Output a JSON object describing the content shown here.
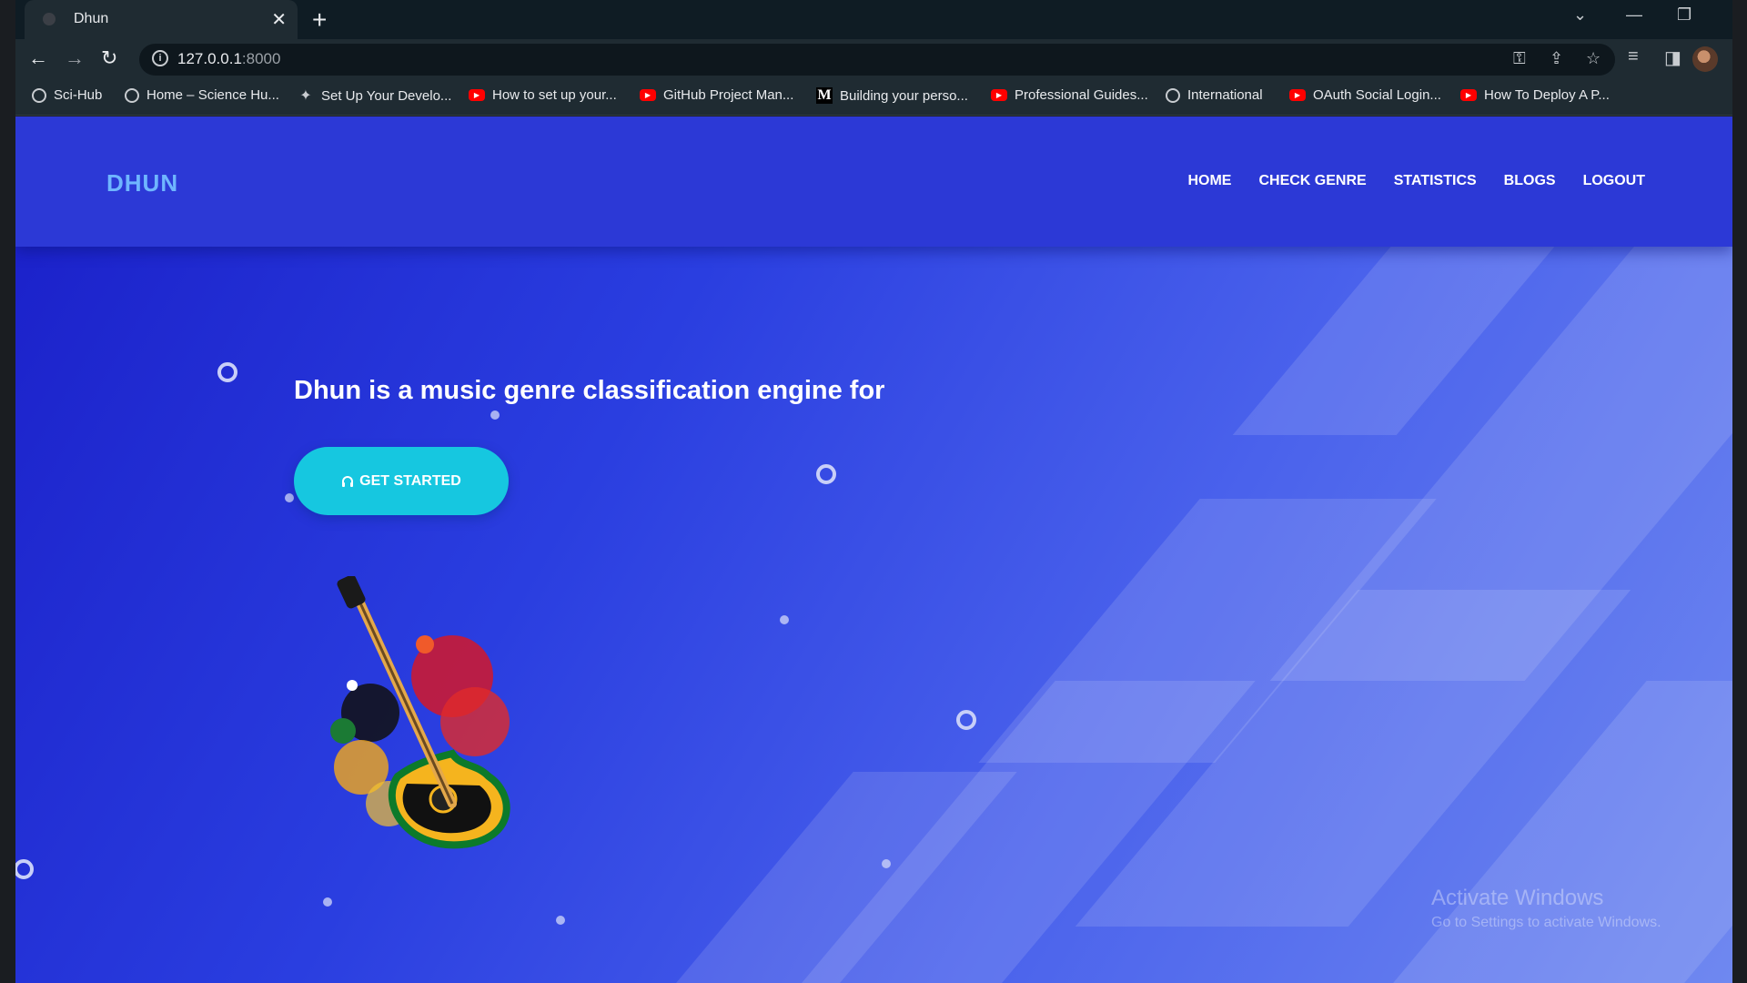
{
  "browser": {
    "tab_title": "Dhun",
    "url_host": "127.0.0.1",
    "url_port": ":8000",
    "bookmarks": [
      {
        "label": "Sci-Hub",
        "icon": "globe-icon"
      },
      {
        "label": "Home – Science Hu...",
        "icon": "globe-icon"
      },
      {
        "label": "Set Up Your Develo...",
        "icon": "gear-icon"
      },
      {
        "label": "How to set up your...",
        "icon": "youtube-icon"
      },
      {
        "label": "GitHub Project Man...",
        "icon": "youtube-icon"
      },
      {
        "label": "Building your perso...",
        "icon": "medium-icon"
      },
      {
        "label": "Professional Guides...",
        "icon": "youtube-icon"
      },
      {
        "label": "International",
        "icon": "globe-icon"
      },
      {
        "label": "OAuth Social Login...",
        "icon": "youtube-icon"
      },
      {
        "label": "How To Deploy A P...",
        "icon": "youtube-icon"
      }
    ]
  },
  "site": {
    "logo": "DHUN",
    "nav": [
      "HOME",
      "CHECK GENRE",
      "STATISTICS",
      "BLOGS",
      "LOGOUT"
    ],
    "hero_text": "Dhun is a music genre classification engine for",
    "cta_label": "GET STARTED",
    "cta_icon": "headphones-icon"
  },
  "watermark": {
    "line1": "Activate Windows",
    "line2": "Go to Settings to activate Windows."
  },
  "colors": {
    "navbar": "#2c39d6",
    "logo": "#6fb6ff",
    "cta": "#16c7e0"
  }
}
